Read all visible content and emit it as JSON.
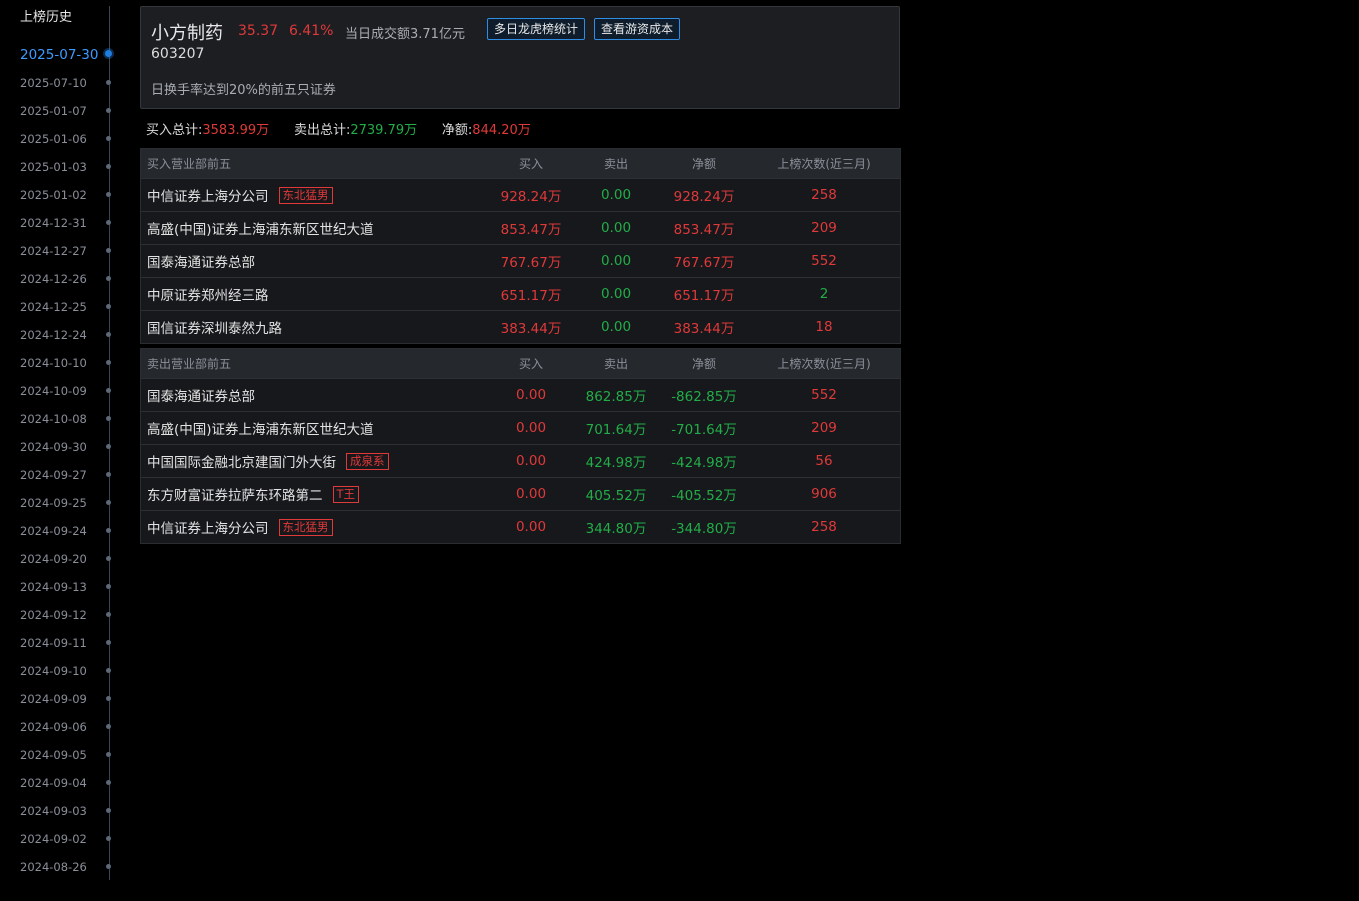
{
  "sidebar": {
    "title": "上榜历史",
    "dates": [
      "2025-07-30",
      "2025-07-10",
      "2025-01-07",
      "2025-01-06",
      "2025-01-03",
      "2025-01-02",
      "2024-12-31",
      "2024-12-27",
      "2024-12-26",
      "2024-12-25",
      "2024-12-24",
      "2024-10-10",
      "2024-10-09",
      "2024-10-08",
      "2024-09-30",
      "2024-09-27",
      "2024-09-25",
      "2024-09-24",
      "2024-09-20",
      "2024-09-13",
      "2024-09-12",
      "2024-09-11",
      "2024-09-10",
      "2024-09-09",
      "2024-09-06",
      "2024-09-05",
      "2024-09-04",
      "2024-09-03",
      "2024-09-02",
      "2024-08-26"
    ],
    "active_date": "2025-07-30"
  },
  "header": {
    "name": "小方制药",
    "price": "35.37",
    "change": "6.41%",
    "turnover": "当日成交额3.71亿元",
    "btn_multi": "多日龙虎榜统计",
    "btn_cost": "查看游资成本",
    "code": "603207",
    "reason": "日换手率达到20%的前五只证券"
  },
  "totals": {
    "buy_label": "买入总计:",
    "buy_value": "3583.99万",
    "sell_label": "卖出总计:",
    "sell_value": "2739.79万",
    "net_label": "净额:",
    "net_value": "844.20万"
  },
  "buy_table": {
    "headers": [
      "买入营业部前五",
      "买入",
      "卖出",
      "净额",
      "上榜次数(近三月)"
    ],
    "rows": [
      {
        "name": "中信证券上海分公司",
        "tag": "东北猛男",
        "buy": "928.24万",
        "sell": "0.00",
        "net": "928.24万",
        "times": "258",
        "times_color": "#e0393a"
      },
      {
        "name": "高盛(中国)证券上海浦东新区世纪大道",
        "tag": "",
        "buy": "853.47万",
        "sell": "0.00",
        "net": "853.47万",
        "times": "209",
        "times_color": "#e0393a"
      },
      {
        "name": "国泰海通证券总部",
        "tag": "",
        "buy": "767.67万",
        "sell": "0.00",
        "net": "767.67万",
        "times": "552",
        "times_color": "#e0393a"
      },
      {
        "name": "中原证券郑州经三路",
        "tag": "",
        "buy": "651.17万",
        "sell": "0.00",
        "net": "651.17万",
        "times": "2",
        "times_color": "#22ad48"
      },
      {
        "name": "国信证券深圳泰然九路",
        "tag": "",
        "buy": "383.44万",
        "sell": "0.00",
        "net": "383.44万",
        "times": "18",
        "times_color": "#e0393a"
      }
    ]
  },
  "sell_table": {
    "headers": [
      "卖出营业部前五",
      "买入",
      "卖出",
      "净额",
      "上榜次数(近三月)"
    ],
    "rows": [
      {
        "name": "国泰海通证券总部",
        "tag": "",
        "buy": "0.00",
        "sell": "862.85万",
        "net": "-862.85万",
        "times": "552",
        "times_color": "#e0393a"
      },
      {
        "name": "高盛(中国)证券上海浦东新区世纪大道",
        "tag": "",
        "buy": "0.00",
        "sell": "701.64万",
        "net": "-701.64万",
        "times": "209",
        "times_color": "#e0393a"
      },
      {
        "name": "中国国际金融北京建国门外大街",
        "tag": "成泉系",
        "buy": "0.00",
        "sell": "424.98万",
        "net": "-424.98万",
        "times": "56",
        "times_color": "#e0393a"
      },
      {
        "name": "东方财富证券拉萨东环路第二",
        "tag": "T王",
        "buy": "0.00",
        "sell": "405.52万",
        "net": "-405.52万",
        "times": "906",
        "times_color": "#e0393a"
      },
      {
        "name": "中信证券上海分公司",
        "tag": "东北猛男",
        "buy": "0.00",
        "sell": "344.80万",
        "net": "-344.80万",
        "times": "258",
        "times_color": "#e0393a"
      }
    ]
  },
  "colors": {
    "up": "#e0393a",
    "down": "#22ad48",
    "accent": "#2f8de4"
  }
}
